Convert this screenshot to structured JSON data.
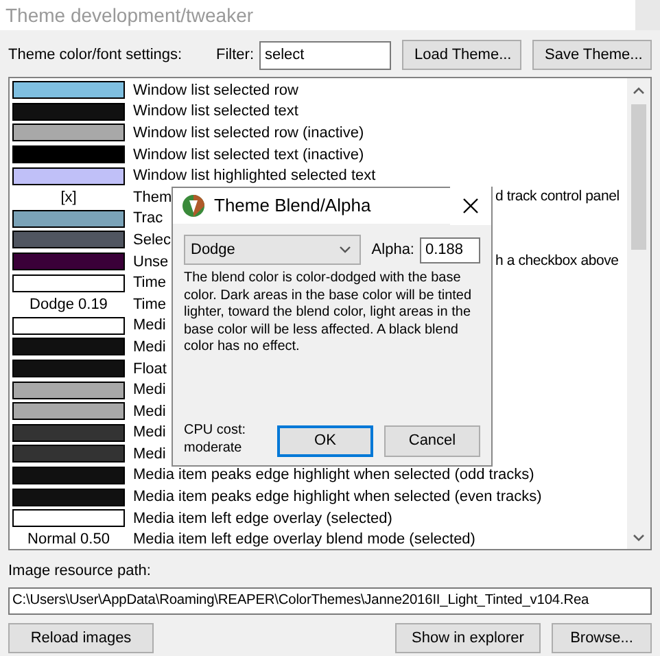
{
  "window": {
    "title": "Theme development/tweaker"
  },
  "toolbar": {
    "settings_label": "Theme color/font settings:",
    "filter_label": "Filter:",
    "filter_value": "select",
    "buttons": [
      "Load Theme...",
      "Save Theme..."
    ]
  },
  "settings": [
    {
      "kind": "color",
      "color": "#7fbfe0",
      "label": "Window list selected row"
    },
    {
      "kind": "color",
      "color": "#111111",
      "label": "Window list selected text"
    },
    {
      "kind": "color",
      "color": "#a8a8a8",
      "label": "Window list selected row (inactive)"
    },
    {
      "kind": "color",
      "color": "#000000",
      "label": "Window list selected text (inactive)"
    },
    {
      "kind": "color",
      "color": "#c0c0f8",
      "label": "Window list highlighted selected text"
    },
    {
      "kind": "text",
      "value": "[x]",
      "label": "Them",
      "tail": "d track control panel"
    },
    {
      "kind": "color",
      "color": "#7ba3b8",
      "label": "Trac"
    },
    {
      "kind": "color",
      "color": "#505560",
      "label": "Selec"
    },
    {
      "kind": "color",
      "color": "#3a0038",
      "label": "Unse",
      "tail": "h a checkbox above"
    },
    {
      "kind": "color",
      "color": "#ffffff",
      "label": "Time"
    },
    {
      "kind": "text",
      "value": "Dodge 0.19",
      "label": "Time"
    },
    {
      "kind": "color",
      "color": "#ffffff",
      "label": "Medi"
    },
    {
      "kind": "color",
      "color": "#111111",
      "label": "Medi"
    },
    {
      "kind": "color",
      "color": "#111111",
      "label": "Float"
    },
    {
      "kind": "color",
      "color": "#a8a8a8",
      "label": "Medi"
    },
    {
      "kind": "color",
      "color": "#a8a8a8",
      "label": "Medi"
    },
    {
      "kind": "color",
      "color": "#333333",
      "label": "Medi"
    },
    {
      "kind": "color",
      "color": "#333333",
      "label": "Medi"
    },
    {
      "kind": "color",
      "color": "#111111",
      "label": "Media item peaks edge highlight when selected (odd tracks)"
    },
    {
      "kind": "color",
      "color": "#111111",
      "label": "Media item peaks edge highlight when selected (even tracks)"
    },
    {
      "kind": "color",
      "color": "#ffffff",
      "label": "Media item left edge overlay (selected)"
    },
    {
      "kind": "text",
      "value": "Normal 0.50",
      "label": "Media item left edge overlay blend mode (selected)"
    }
  ],
  "image_path": {
    "label": "Image resource path:",
    "value": "C:\\Users\\User\\AppData\\Roaming\\REAPER\\ColorThemes\\Janne2016II_Light_Tinted_v104.Rea"
  },
  "bottom_buttons": [
    "Reload images",
    "Show in explorer",
    "Browse..."
  ],
  "dialog": {
    "title": "Theme Blend/Alpha",
    "mode": "Dodge",
    "alpha_label": "Alpha:",
    "alpha": "0.188",
    "description": "The blend color is color-dodged with the base color. Dark areas in the base color will be tinted lighter, toward the blend color, light areas in the base color will be less affected. A black blend color has no effect.",
    "cpu_cost": "CPU cost: moderate",
    "buttons": [
      "OK",
      "Cancel"
    ]
  }
}
